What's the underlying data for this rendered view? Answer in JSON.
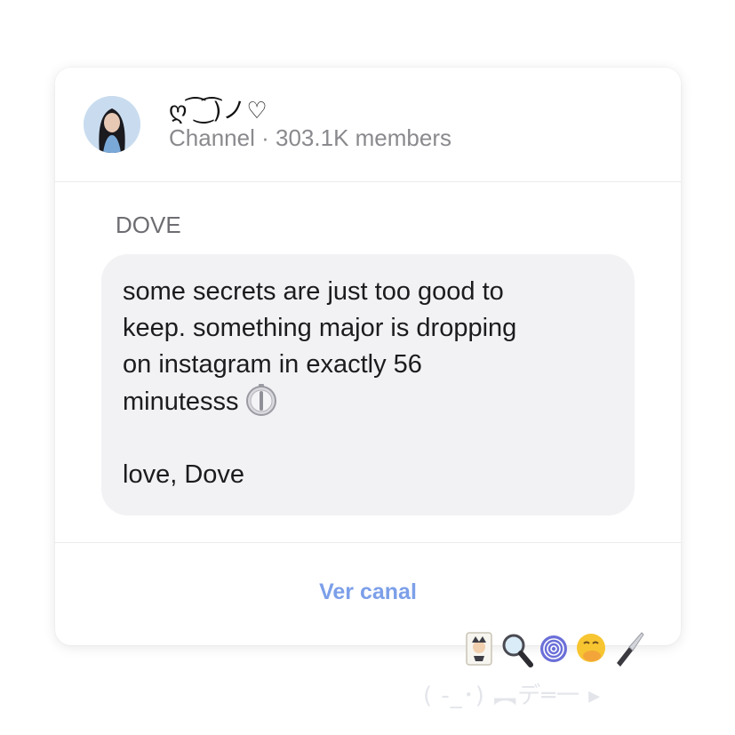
{
  "channel": {
    "name": "ღ ͡ ͜ ͡)ノ♡",
    "type": "Channel",
    "separator": "·",
    "members": "303.1K members"
  },
  "message": {
    "sender": "DOVE",
    "lines": [
      "some secrets are just too good to",
      "keep. something major is dropping",
      "on instagram in exactly 56",
      "minutesss"
    ],
    "signoff": "love, Dove"
  },
  "actions": {
    "view_channel": "Ver canal"
  },
  "decorations": {
    "emojis": [
      "joker-card-icon",
      "magnifier-icon",
      "fingerprint-icon",
      "hand-over-mouth-face-icon",
      "knife-icon"
    ],
    "signature": "( -_･) ︻デ═一 ▸"
  },
  "colors": {
    "accent": "#7c9fe9",
    "bubble": "#f2f2f5",
    "meta_text": "#8a8a8e"
  }
}
